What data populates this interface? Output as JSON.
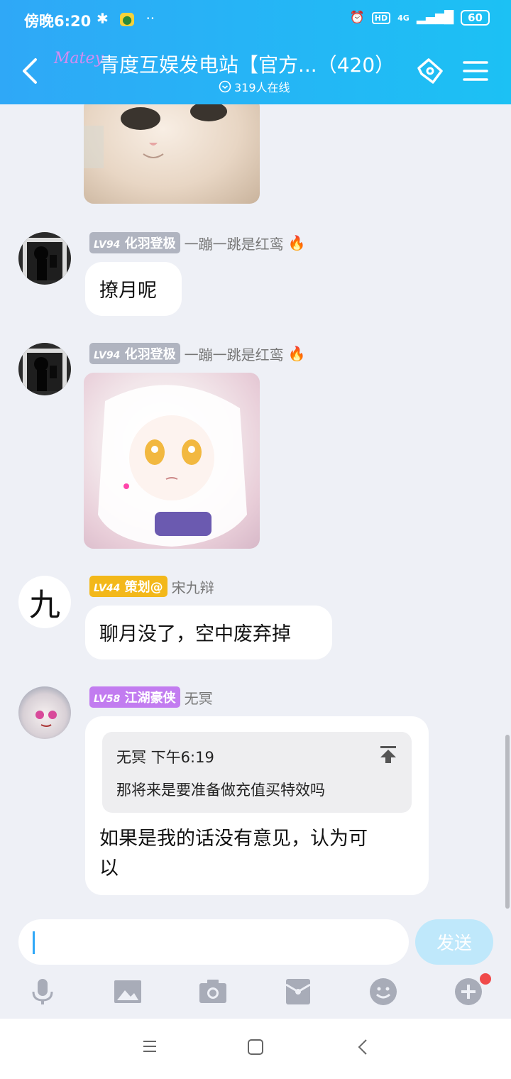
{
  "status_bar": {
    "time": "傍晚6:20",
    "battery": "60",
    "network": "4G",
    "hd": "HD"
  },
  "header": {
    "logo_text": "Matey",
    "title": "青度互娱发电站【官方...（420）",
    "online": "319人在线"
  },
  "messages": [
    {
      "level": "LV94",
      "role": "化羽登极",
      "name": "一蹦一跳是红鸾",
      "flame": "🔥",
      "text": "撩月呢"
    },
    {
      "level": "LV94",
      "role": "化羽登极",
      "name": "一蹦一跳是红鸾",
      "flame": "🔥"
    },
    {
      "level": "LV44",
      "role": "策划@",
      "name": "宋九辩",
      "avatar_char": "九",
      "text": "聊月没了，空中废弃掉"
    },
    {
      "level": "LV58",
      "role": "江湖豪侠",
      "name": "无冥",
      "quote": {
        "author_time": "无冥 下午6:19",
        "text": "那将来是要准备做充值买特效吗"
      },
      "text_line1": "如果是我的话没有意见，认为可",
      "text_line2": "以"
    }
  ],
  "input": {
    "placeholder": "",
    "send_label": "发送"
  },
  "toolbar": [
    "mic-icon",
    "image-icon",
    "camera-icon",
    "red-packet-icon",
    "emoji-icon",
    "plus-icon"
  ],
  "colors": {
    "header": "#2fa8f7",
    "send_disabled": "#bfe8fb",
    "badge_gold": "#f3b81a",
    "badge_purple": "#c27cf0",
    "badge_gray": "#b0b4c0",
    "notify_dot": "#f04a4a"
  }
}
